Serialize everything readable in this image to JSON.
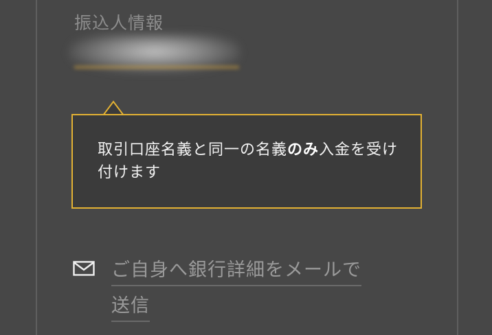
{
  "payer_section": {
    "label": "振込人情報"
  },
  "tooltip": {
    "text_part1": "取引口座名義と同一の名義",
    "text_bold": "のみ",
    "text_part2": "入金を受け付けます",
    "border_color": "#e4b233"
  },
  "email_action": {
    "icon": "envelope-icon",
    "label_line1": "ご自身へ銀行詳細をメールで",
    "label_line2": "送信"
  }
}
